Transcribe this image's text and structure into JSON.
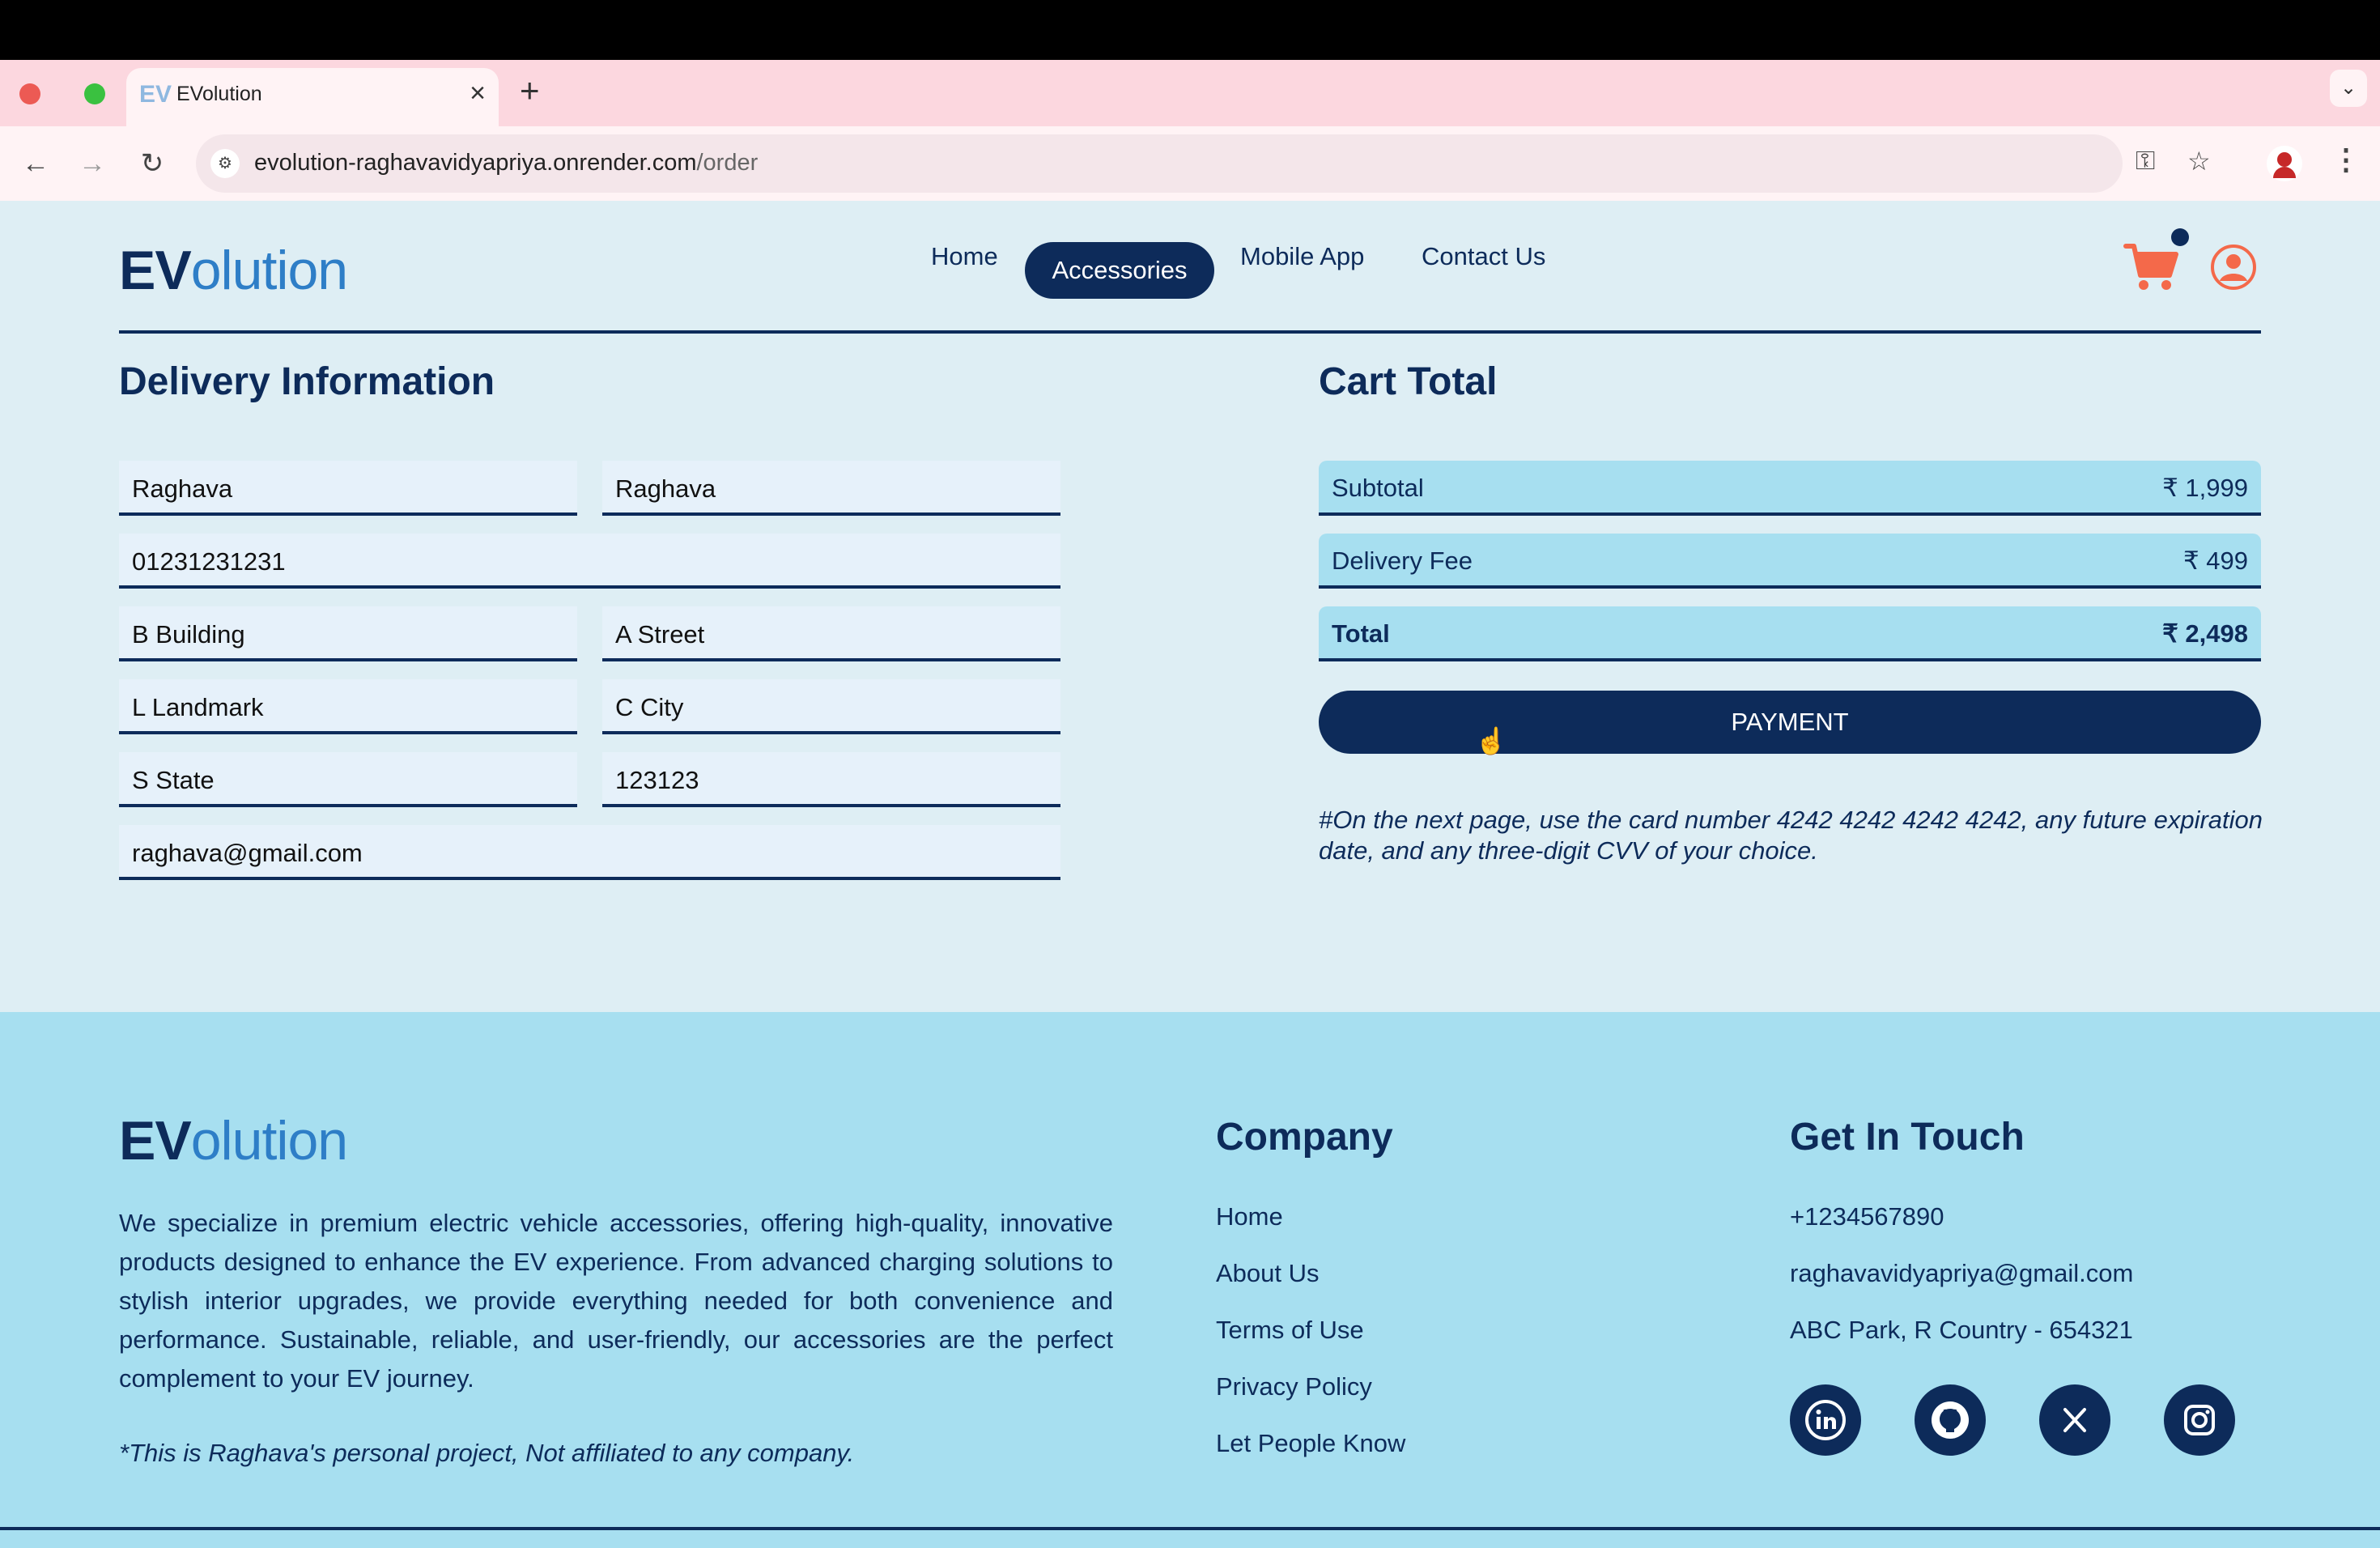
{
  "browser": {
    "tab_title": "EVolution",
    "tab_favicon": "EV",
    "url_domain": "evolution-raghavavidyapriya.onrender.com",
    "url_path": "/order"
  },
  "header": {
    "logo_ev": "EV",
    "logo_rest": "olution",
    "nav": [
      "Home",
      "Accessories",
      "Mobile App",
      "Contact Us"
    ],
    "active_nav": "Accessories",
    "cart_icon": "shopping-cart-icon",
    "user_icon": "user-circle-icon"
  },
  "delivery": {
    "title": "Delivery Information",
    "first_name": "Raghava",
    "last_name": "Raghava",
    "phone": "01231231231",
    "building": "B Building",
    "street": "A Street",
    "landmark": "L Landmark",
    "city": "C City",
    "state": "S State",
    "pincode": "123123",
    "email": "raghava@gmail.com"
  },
  "cart": {
    "title": "Cart Total",
    "subtotal_label": "Subtotal",
    "subtotal_value": "₹ 1,999",
    "delivery_label": "Delivery Fee",
    "delivery_value": "₹ 499",
    "total_label": "Total",
    "total_value": "₹ 2,498",
    "payment_button": "PAYMENT",
    "note": "#On the next page, use the card number 4242 4242 4242 4242, any future expiration date, and any three-digit CVV of your choice."
  },
  "footer": {
    "logo_ev": "EV",
    "logo_rest": "olution",
    "about": "We specialize in premium electric vehicle accessories, offering high-quality, innovative products designed to enhance the EV experience. From advanced charging solutions to stylish interior upgrades, we provide everything needed for both convenience and performance. Sustainable, reliable, and user-friendly, our accessories are the perfect complement to your EV journey.",
    "disclaimer": "*This is Raghava's personal project, Not affiliated to any company.",
    "company_title": "Company",
    "company_links": [
      "Home",
      "About Us",
      "Terms of Use",
      "Privacy Policy",
      "Let People Know"
    ],
    "contact_title": "Get In Touch",
    "phone": "+1234567890",
    "email": "raghavavidyapriya@gmail.com",
    "address": "ABC Park, R Country - 654321",
    "social_icons": [
      "linkedin-icon",
      "github-icon",
      "x-icon",
      "instagram-icon"
    ]
  },
  "colors": {
    "navy": "#0d2b5a",
    "accent_orange": "#f4694a",
    "light_blue": "#a7dff0",
    "page_bg": "#deeef4"
  }
}
